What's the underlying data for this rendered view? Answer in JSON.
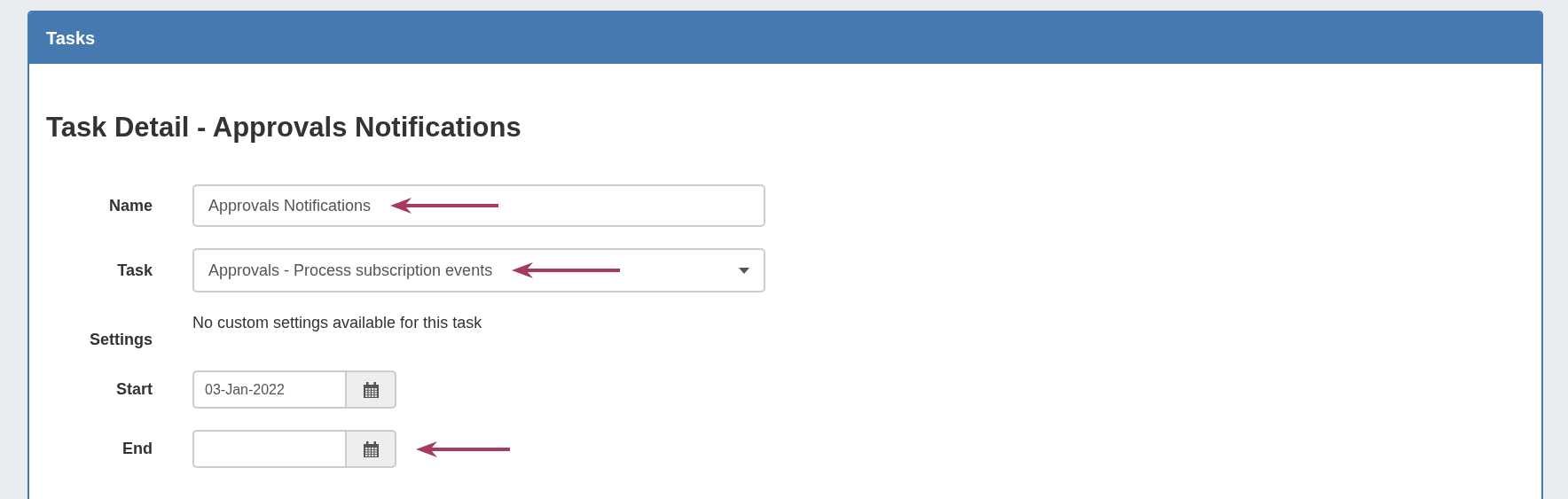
{
  "panel": {
    "title": "Tasks"
  },
  "heading": "Task Detail - Approvals Notifications",
  "fields": [
    {
      "kind": "text",
      "label": "Name",
      "value": "Approvals Notifications",
      "arrow": true
    },
    {
      "kind": "select",
      "label": "Task",
      "value": "Approvals - Process subscription events",
      "arrow": true
    },
    {
      "kind": "static",
      "label": "Settings",
      "value": "No custom settings available for this task"
    },
    {
      "kind": "date",
      "label": "Start",
      "value": "03-Jan-2022",
      "arrow": false
    },
    {
      "kind": "date",
      "label": "End",
      "arrow": true
    }
  ]
}
